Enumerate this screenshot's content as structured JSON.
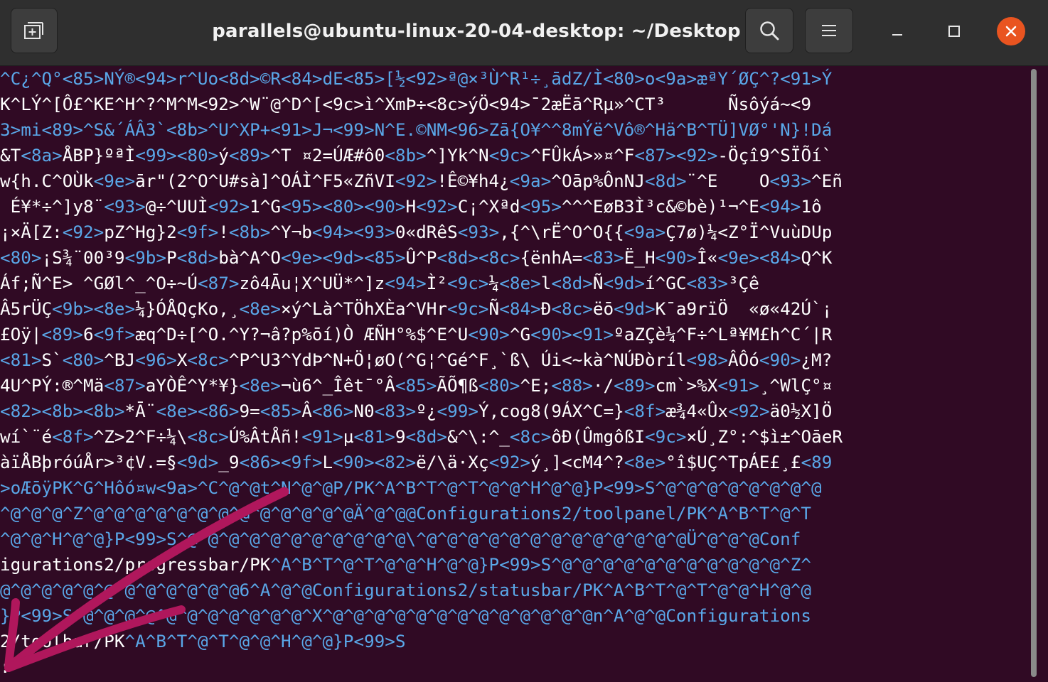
{
  "window": {
    "title": "parallels@ubuntu-linux-20-04-desktop: ~/Desktop"
  },
  "colors": {
    "titlebar": "#2f2f2f",
    "terminal_bg": "#300a24",
    "escape_text": "#5aa7e8",
    "close_button": "#e95420",
    "annotation_arrow": "#b0175c"
  },
  "icons": [
    "new-tab-icon",
    "search-icon",
    "hamburger-menu-icon",
    "minimize-icon",
    "maximize-icon",
    "close-icon",
    "annotation-arrow-icon"
  ],
  "terminal": {
    "lines": [
      [
        [
          "c",
          "^C¿^Q°<85>NÝ®<94>r^Uo<8d>©R<84>dE<85>[½<92>ª@×³Ù^R¹÷¸ādZ/Ì<80>o<9a>æªY´ØÇ^?<91>Ý"
        ]
      ],
      [
        [
          "t",
          "K^LÝ^[Ô£^KE^H^?^M^M<92>^W¨@^D^[<9c>ì^XmÞ÷<8c>ýÖ<94>¯2æËā^Rµ»^CT³      Ñsôýá~<9"
        ]
      ],
      [
        [
          "c",
          "3>mi<89>^S&´ÁÂ3`<8b>^U^XP+<91>J¬<99>N^E.©NM<96>Zā{O¥^^8mÝë^Vô®^Hä^B^TÜ]VØ°'N}!Dá"
        ]
      ],
      [
        [
          "t",
          "&T"
        ],
        [
          "c",
          "<8a>"
        ],
        [
          "t",
          "ÅBP}ºªÌ"
        ],
        [
          "c",
          "<99><80>"
        ],
        [
          "t",
          "ý"
        ],
        [
          "c",
          "<89>"
        ],
        [
          "t",
          "^T ¤2=ÚÆ#ô0"
        ],
        [
          "c",
          "<8b>"
        ],
        [
          "t",
          "^]Yk^N"
        ],
        [
          "c",
          "<9c>"
        ],
        [
          "t",
          "^FÛkÁ>»¤^F"
        ],
        [
          "c",
          "<87><92>"
        ],
        [
          "t",
          "-Öçî9^SÏÕí`"
        ]
      ],
      [
        [
          "t",
          "w{h.C^OÙk"
        ],
        [
          "c",
          "<9e>"
        ],
        [
          "t",
          "ār\"(2^O^U#sà]^OÁÌ^F5«ZñVI"
        ],
        [
          "c",
          "<92>"
        ],
        [
          "t",
          "!Ê©¥h4¿"
        ],
        [
          "c",
          "<9a>"
        ],
        [
          "t",
          "^Oāp%ÔnNJ"
        ],
        [
          "c",
          "<8d>"
        ],
        [
          "t",
          "¨^E    O"
        ],
        [
          "c",
          "<93>"
        ],
        [
          "t",
          "^Eñ"
        ]
      ],
      [
        [
          "t",
          " É¥*÷^]y8¨"
        ],
        [
          "c",
          "<93>"
        ],
        [
          "t",
          "@÷^UUÌ"
        ],
        [
          "c",
          "<92>"
        ],
        [
          "t",
          "1^G"
        ],
        [
          "c",
          "<95><80><90>"
        ],
        [
          "t",
          "H"
        ],
        [
          "c",
          "<92>"
        ],
        [
          "t",
          "C¡^Xªd"
        ],
        [
          "c",
          "<95>"
        ],
        [
          "t",
          "^^^EøB3Ì³c&©bè)¹¬^E"
        ],
        [
          "c",
          "<94>"
        ],
        [
          "t",
          "1ô"
        ]
      ],
      [
        [
          "t",
          "¡×Ä[Z:"
        ],
        [
          "c",
          "<92>"
        ],
        [
          "t",
          "pZ^Hg}2"
        ],
        [
          "c",
          "<9f>"
        ],
        [
          "t",
          "!"
        ],
        [
          "c",
          "<8b>"
        ],
        [
          "t",
          "^Y¬b"
        ],
        [
          "c",
          "<94><93>"
        ],
        [
          "t",
          "0«dRêS"
        ],
        [
          "c",
          "<93>"
        ],
        [
          "t",
          ",{^\\rË^O^O{{"
        ],
        [
          "c",
          "<9a>"
        ],
        [
          "t",
          "Ç7ø)¼<Z°Ï^VuùDUp"
        ]
      ],
      [
        [
          "c",
          "<80>"
        ],
        [
          "t",
          "¡S¾¨00³9"
        ],
        [
          "c",
          "<9b>"
        ],
        [
          "t",
          "P"
        ],
        [
          "c",
          "<8d>"
        ],
        [
          "t",
          "bà^A^O"
        ],
        [
          "c",
          "<9e><9d><85>"
        ],
        [
          "t",
          "Û^P"
        ],
        [
          "c",
          "<8d><8c>"
        ],
        [
          "t",
          "{ënhA="
        ],
        [
          "c",
          "<83>"
        ],
        [
          "t",
          "Ë_H"
        ],
        [
          "c",
          "<90>"
        ],
        [
          "t",
          "Î«"
        ],
        [
          "c",
          "<9e><84>"
        ],
        [
          "t",
          "Q^K"
        ]
      ],
      [
        [
          "t",
          "Áf;Ñ^E> ^GØl^_^O÷~Ú"
        ],
        [
          "c",
          "<87>"
        ],
        [
          "t",
          "zô4Āu¦X^UÜ*^]z"
        ],
        [
          "c",
          "<94>"
        ],
        [
          "t",
          "Ì²"
        ],
        [
          "c",
          "<9c>"
        ],
        [
          "t",
          "¼"
        ],
        [
          "c",
          "<8e>"
        ],
        [
          "t",
          "l"
        ],
        [
          "c",
          "<8d>"
        ],
        [
          "t",
          "Ñ"
        ],
        [
          "c",
          "<9d>"
        ],
        [
          "t",
          "í^GC"
        ],
        [
          "c",
          "<83>"
        ],
        [
          "t",
          "³Çê"
        ]
      ],
      [
        [
          "t",
          "Â5rÜÇ"
        ],
        [
          "c",
          "<9b><8e>"
        ],
        [
          "t",
          "¼}ÓÅQçKo,¸"
        ],
        [
          "c",
          "<8e>"
        ],
        [
          "t",
          "×ý^Là^TÖhXÈa^VHr"
        ],
        [
          "c",
          "<9c>"
        ],
        [
          "t",
          "Ñ"
        ],
        [
          "c",
          "<84>"
        ],
        [
          "t",
          "Ð"
        ],
        [
          "c",
          "<8c>"
        ],
        [
          "t",
          "ëō"
        ],
        [
          "c",
          "<9d>"
        ],
        [
          "t",
          "K¯a9rïÖ  «ø«42Ú`¡"
        ]
      ],
      [
        [
          "t",
          "£Oÿ|"
        ],
        [
          "c",
          "<89>"
        ],
        [
          "t",
          "6"
        ],
        [
          "c",
          "<9f>"
        ],
        [
          "t",
          "æq^D÷[^O.^Y?¬â?p%ōí)Ò ÆÑH°%$^E^U"
        ],
        [
          "c",
          "<90>"
        ],
        [
          "t",
          "^G"
        ],
        [
          "c",
          "<90><91>"
        ],
        [
          "t",
          "ºaZÇè¼^F÷^Lª¥M£h^C´|R"
        ]
      ],
      [
        [
          "c",
          "<81>"
        ],
        [
          "t",
          "S`"
        ],
        [
          "c",
          "<80>"
        ],
        [
          "t",
          "^BJ"
        ],
        [
          "c",
          "<96>"
        ],
        [
          "t",
          "X"
        ],
        [
          "c",
          "<8c>"
        ],
        [
          "t",
          "^P^U3^YdÞ^N+Ö¦øO(^G¦^Gé^F¸`ß\\ Úi<~kà^NÚÐòríl"
        ],
        [
          "c",
          "<98>"
        ],
        [
          "t",
          "ÂÔó"
        ],
        [
          "c",
          "<90>"
        ],
        [
          "t",
          "¿M?"
        ]
      ],
      [
        [
          "t",
          "4U^PÝ:®^Mä"
        ],
        [
          "c",
          "<87>"
        ],
        [
          "t",
          "aYÒÊ^Y*¥}"
        ],
        [
          "c",
          "<8e>"
        ],
        [
          "t",
          "¬ù6^_Îêt¯°Â"
        ],
        [
          "c",
          "<85>"
        ],
        [
          "t",
          "ÃÕ¶ß"
        ],
        [
          "c",
          "<80>"
        ],
        [
          "t",
          "^E;"
        ],
        [
          "c",
          "<88>"
        ],
        [
          "t",
          "·/"
        ],
        [
          "c",
          "<89>"
        ],
        [
          "t",
          "cm`>%X"
        ],
        [
          "c",
          "<91>"
        ],
        [
          "t",
          "¸^WlÇ°¤"
        ]
      ],
      [
        [
          "c",
          "<82><8b><8b>"
        ],
        [
          "t",
          "*Ā¨"
        ],
        [
          "c",
          "<8e><86>"
        ],
        [
          "t",
          "9="
        ],
        [
          "c",
          "<85>"
        ],
        [
          "t",
          "Â"
        ],
        [
          "c",
          "<86>"
        ],
        [
          "t",
          "N0"
        ],
        [
          "c",
          "<83>"
        ],
        [
          "t",
          "º¿"
        ],
        [
          "c",
          "<99>"
        ],
        [
          "t",
          "Ý,cog8(9ÁX^C=}"
        ],
        [
          "c",
          "<8f>"
        ],
        [
          "t",
          "æ¾4«Ûx"
        ],
        [
          "c",
          "<92>"
        ],
        [
          "t",
          "ä0½X]Ö"
        ]
      ],
      [
        [
          "t",
          "wí`¨é"
        ],
        [
          "c",
          "<8f>"
        ],
        [
          "t",
          "^Z>2^F÷¼\\"
        ],
        [
          "c",
          "<8c>"
        ],
        [
          "t",
          "Ú%ÂtÅñ!"
        ],
        [
          "c",
          "<91>"
        ],
        [
          "t",
          "µ"
        ],
        [
          "c",
          "<81>"
        ],
        [
          "t",
          "9"
        ],
        [
          "c",
          "<8d>"
        ],
        [
          "t",
          "&^\\:^_"
        ],
        [
          "c",
          "<8c>"
        ],
        [
          "t",
          "ôĐ(ÛmgôßI"
        ],
        [
          "c",
          "<9c>"
        ],
        [
          "t",
          "×Ú¸Z°:^$ì±^OāeR"
        ]
      ],
      [
        [
          "t",
          "àïÅBþróúÅr>³¢V.=§"
        ],
        [
          "c",
          "<9d>"
        ],
        [
          "t",
          "_9"
        ],
        [
          "c",
          "<86><9f>"
        ],
        [
          "t",
          "L"
        ],
        [
          "c",
          "<90><82>"
        ],
        [
          "t",
          "ë/\\ä·Xç"
        ],
        [
          "c",
          "<92>"
        ],
        [
          "t",
          "ý¸]<cM4^?"
        ],
        [
          "c",
          "<8e>"
        ],
        [
          "t",
          "°î$UÇ^TpÁE£¸£"
        ],
        [
          "c",
          "<89"
        ]
      ],
      [
        [
          "c",
          ">oÆōÿPK^G^Hôó¤w<9a>^C^@^@t^N^@^@P/PK^A^B^T^@^T^@^@^H^@^@}P<99>S^@^@^@^@^@^@^@^@"
        ]
      ],
      [
        [
          "c",
          "^@^@^@^Z^@^@^@^@^@^@^@^@^@^@^@^@^@Ä^@^@@Configurations2/toolpanel/PK^A^B^T^@^T"
        ]
      ],
      [
        [
          "c",
          "^@^@^H^@^@}P<99>S^@^@^@^@^@^@^@^@^@^@^@\\^@^@^@^@^@^@^@^@^@^@^@^@^@Ü^@^@^@Conf"
        ]
      ],
      [
        [
          "t",
          "igurations2/progressbar/PK"
        ],
        [
          "c",
          "^A^B^T^@^T^@^@^H^@^@}P<99>S^@^@^@^@^@^@^@^@^@^@^@^Z^"
        ]
      ],
      [
        [
          "c",
          "@^@^@^@^@^@^@^@^@^@^@^@6^A^@^@Configurations2/statusbar/PK^A^B^T^@^T^@^@^H^@^@"
        ]
      ],
      [
        [
          "c",
          "}P<99>S^@^@^@^@^@^@^@^@^@^@^@^X^@^@^@^@^@^@^@^@^@^@^@^@^@n^A^@^@Configurations"
        ]
      ],
      [
        [
          "t",
          "2/toolbar/PK"
        ],
        [
          "c",
          "^A^B^T^@^T^@^@^H^@^@}P<99>S"
        ]
      ],
      [
        [
          "t",
          ":"
        ]
      ]
    ]
  }
}
